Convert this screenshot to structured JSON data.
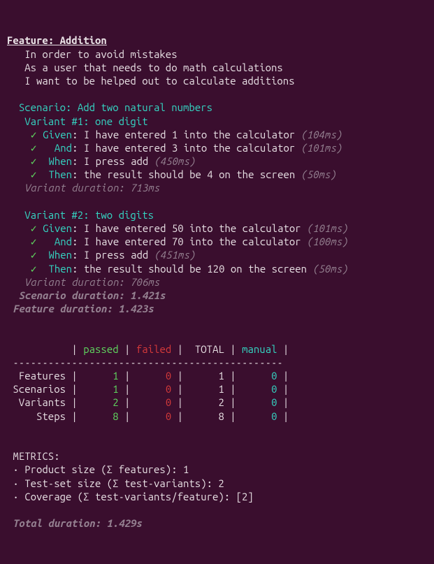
{
  "feature": {
    "title_label": "Feature",
    "title_name": "Addition",
    "narrative": {
      "line1": "In order to avoid mistakes",
      "line2": "As a user that needs to do math calculations",
      "line3": "I want to be helped out to calculate additions"
    },
    "scenario": {
      "label": "Scenario",
      "name": "Add two natural numbers",
      "variants": [
        {
          "heading": "Variant #1: one digit",
          "steps": [
            {
              "kw": "Given",
              "text": "I have entered 1 into the calculator",
              "time": "(104ms)"
            },
            {
              "kw": "  And",
              "text": "I have entered 3 into the calculator",
              "time": "(101ms)"
            },
            {
              "kw": " When",
              "text": "I press add",
              "time": "(450ms)"
            },
            {
              "kw": " Then",
              "text": "the result should be 4 on the screen",
              "time": "(50ms)"
            }
          ],
          "duration": "Variant duration: 713ms"
        },
        {
          "heading": "Variant #2: two digits",
          "steps": [
            {
              "kw": "Given",
              "text": "I have entered 50 into the calculator",
              "time": "(101ms)"
            },
            {
              "kw": "  And",
              "text": "I have entered 70 into the calculator",
              "time": "(100ms)"
            },
            {
              "kw": " When",
              "text": "I press add",
              "time": "(451ms)"
            },
            {
              "kw": " Then",
              "text": "the result should be 120 on the screen",
              "time": "(50ms)"
            }
          ],
          "duration": "Variant duration: 706ms"
        }
      ],
      "scenario_duration": "Scenario duration: 1.421s"
    },
    "feature_duration": "Feature duration: 1.423s"
  },
  "check_glyph": "✓",
  "table": {
    "hdr": {
      "c1": "passed",
      "c2": "failed",
      "c3": "TOTAL",
      "c4": "manual"
    },
    "rows": [
      {
        "label": " Features",
        "passed": "1",
        "failed": "0",
        "total": "1",
        "manual": "0"
      },
      {
        "label": "Scenarios",
        "passed": "1",
        "failed": "0",
        "total": "1",
        "manual": "0"
      },
      {
        "label": " Variants",
        "passed": "2",
        "failed": "0",
        "total": "2",
        "manual": "0"
      },
      {
        "label": "    Steps",
        "passed": "8",
        "failed": "0",
        "total": "8",
        "manual": "0"
      }
    ],
    "hline": " ----------------------------------------------"
  },
  "metrics": {
    "title": "METRICS:",
    "lines": [
      "· Product size (Σ features): 1",
      "· Test-set size (Σ test-variants): 2",
      "· Coverage (Σ test-variants/feature): [2]"
    ]
  },
  "total_duration": "Total duration: 1.429s"
}
